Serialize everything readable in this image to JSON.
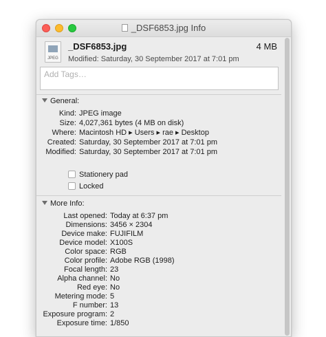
{
  "window": {
    "title": "_DSF6853.jpg Info"
  },
  "header": {
    "icon_label": "JPEG",
    "filename": "_DSF6853.jpg",
    "size": "4 MB",
    "modified": "Modified: Saturday, 30 September 2017 at 7:01 pm"
  },
  "tags": {
    "placeholder": "Add Tags…"
  },
  "general": {
    "heading": "General:",
    "rows": [
      {
        "key": "Kind:",
        "value": "JPEG image"
      },
      {
        "key": "Size:",
        "value": "4,027,361 bytes (4 MB on disk)"
      },
      {
        "key": "Where:",
        "value": "Macintosh HD ▸ Users ▸ rae ▸ Desktop"
      },
      {
        "key": "Created:",
        "value": "Saturday, 30 September 2017 at 7:01 pm"
      },
      {
        "key": "Modified:",
        "value": "Saturday, 30 September 2017 at 7:01 pm"
      }
    ],
    "stationery_label": "Stationery pad",
    "locked_label": "Locked"
  },
  "more_info": {
    "heading": "More Info:",
    "rows": [
      {
        "key": "Last opened:",
        "value": "Today at 6:37 pm"
      },
      {
        "key": "Dimensions:",
        "value": "3456 × 2304"
      },
      {
        "key": "Device make:",
        "value": "FUJIFILM"
      },
      {
        "key": "Device model:",
        "value": "X100S"
      },
      {
        "key": "Color space:",
        "value": "RGB"
      },
      {
        "key": "Color profile:",
        "value": "Adobe RGB (1998)"
      },
      {
        "key": "Focal length:",
        "value": "23"
      },
      {
        "key": "Alpha channel:",
        "value": "No"
      },
      {
        "key": "Red eye:",
        "value": "No"
      },
      {
        "key": "Metering mode:",
        "value": "5"
      },
      {
        "key": "F number:",
        "value": "13"
      },
      {
        "key": "Exposure program:",
        "value": "2"
      },
      {
        "key": "Exposure time:",
        "value": "1/850"
      }
    ]
  }
}
